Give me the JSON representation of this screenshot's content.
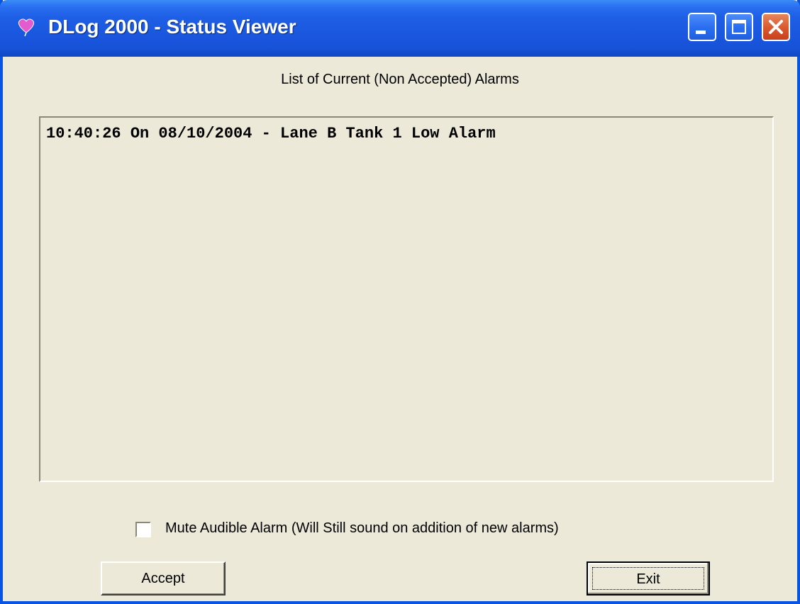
{
  "window": {
    "title": "DLog 2000 - Status Viewer",
    "app_icon": "heart-balloon-icon",
    "controls": {
      "minimize_icon": "minimize-icon",
      "maximize_icon": "maximize-icon",
      "close_icon": "close-icon"
    },
    "colors": {
      "titlebar": "#1e5fe6",
      "close_button": "#d9582e",
      "background": "#ece9d8"
    }
  },
  "main": {
    "heading": "List of Current (Non Accepted) Alarms",
    "alarms": [
      "10:40:26 On 08/10/2004 - Lane B Tank 1 Low Alarm"
    ],
    "mute": {
      "checked": false,
      "label": "Mute Audible Alarm  (Will Still sound on addition of new alarms)"
    },
    "buttons": {
      "accept": "Accept",
      "exit": "Exit"
    }
  }
}
